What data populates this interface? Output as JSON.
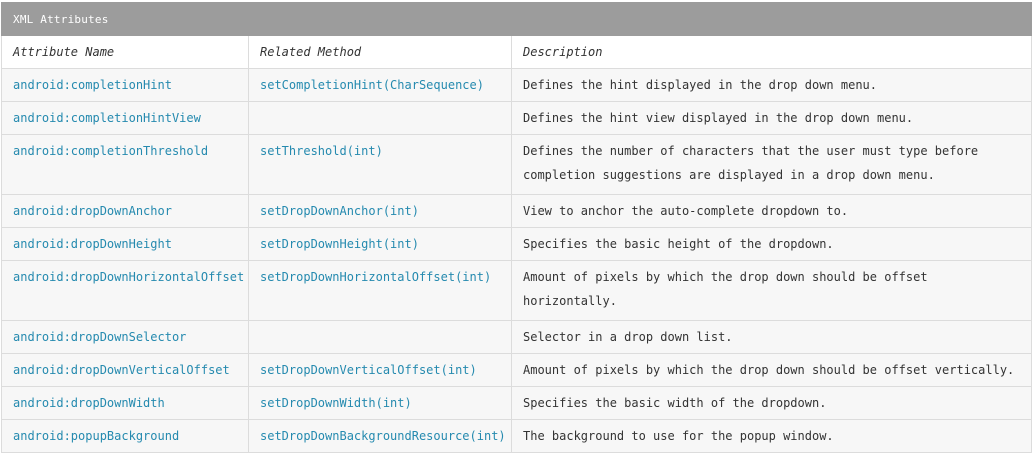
{
  "table": {
    "title": "XML Attributes",
    "headers": [
      "Attribute Name",
      "Related Method",
      "Description"
    ],
    "rows": [
      {
        "attribute": "android:completionHint",
        "method": "setCompletionHint(CharSequence)",
        "description": "Defines the hint displayed in the drop down menu."
      },
      {
        "attribute": "android:completionHintView",
        "method": "",
        "description": "Defines the hint view displayed in the drop down menu."
      },
      {
        "attribute": "android:completionThreshold",
        "method": "setThreshold(int)",
        "description": "Defines the number of characters that the user must type before completion suggestions are displayed in a drop down menu."
      },
      {
        "attribute": "android:dropDownAnchor",
        "method": "setDropDownAnchor(int)",
        "description": "View to anchor the auto-complete dropdown to."
      },
      {
        "attribute": "android:dropDownHeight",
        "method": "setDropDownHeight(int)",
        "description": "Specifies the basic height of the dropdown."
      },
      {
        "attribute": "android:dropDownHorizontalOffset",
        "method": "setDropDownHorizontalOffset(int)",
        "description": "Amount of pixels by which the drop down should be offset horizontally."
      },
      {
        "attribute": "android:dropDownSelector",
        "method": "",
        "description": "Selector in a drop down list."
      },
      {
        "attribute": "android:dropDownVerticalOffset",
        "method": "setDropDownVerticalOffset(int)",
        "description": "Amount of pixels by which the drop down should be offset vertically."
      },
      {
        "attribute": "android:dropDownWidth",
        "method": "setDropDownWidth(int)",
        "description": "Specifies the basic width of the dropdown."
      },
      {
        "attribute": "android:popupBackground",
        "method": "setDropDownBackgroundResource(int)",
        "description": "The background to use for the popup window."
      }
    ]
  },
  "colors": {
    "title_bar": "#9c9c9c",
    "link": "#258aaf",
    "row_background": "#f7f7f7",
    "border": "#dcdcdc"
  }
}
